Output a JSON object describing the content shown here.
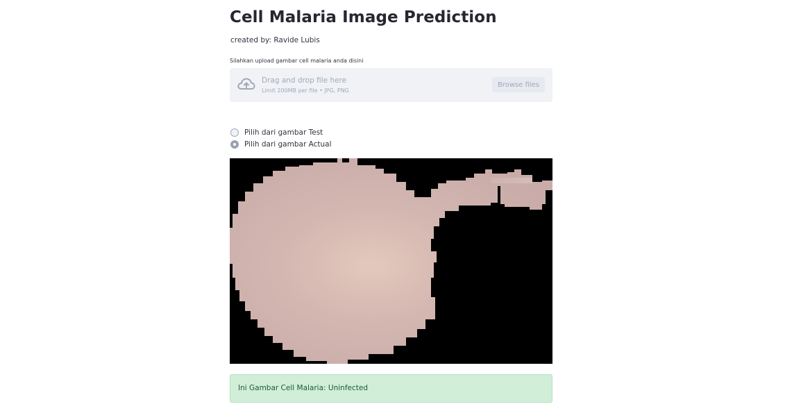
{
  "header": {
    "title": "Cell Malaria Image Prediction",
    "subtitle": "created by: Ravide Lubis"
  },
  "uploader": {
    "label": "Silahkan upload gambar cell malaria anda disini",
    "drop_text": "Drag and drop file here",
    "limit_text": "Limit 200MB per file • JPG, PNG",
    "browse_label": "Browse files",
    "icon": "cloud-upload-icon"
  },
  "source_options": {
    "options": [
      {
        "label": "Pilih dari gambar Test",
        "selected": false
      },
      {
        "label": "Pilih dari gambar Actual",
        "selected": true
      }
    ]
  },
  "result": {
    "text": "Ini Gambar Cell Malaria: Uninfected"
  },
  "colors": {
    "cell": "#cfb3af",
    "background": "#000000",
    "success_bg": "#d0eed8",
    "success_text": "#1d5b34"
  }
}
